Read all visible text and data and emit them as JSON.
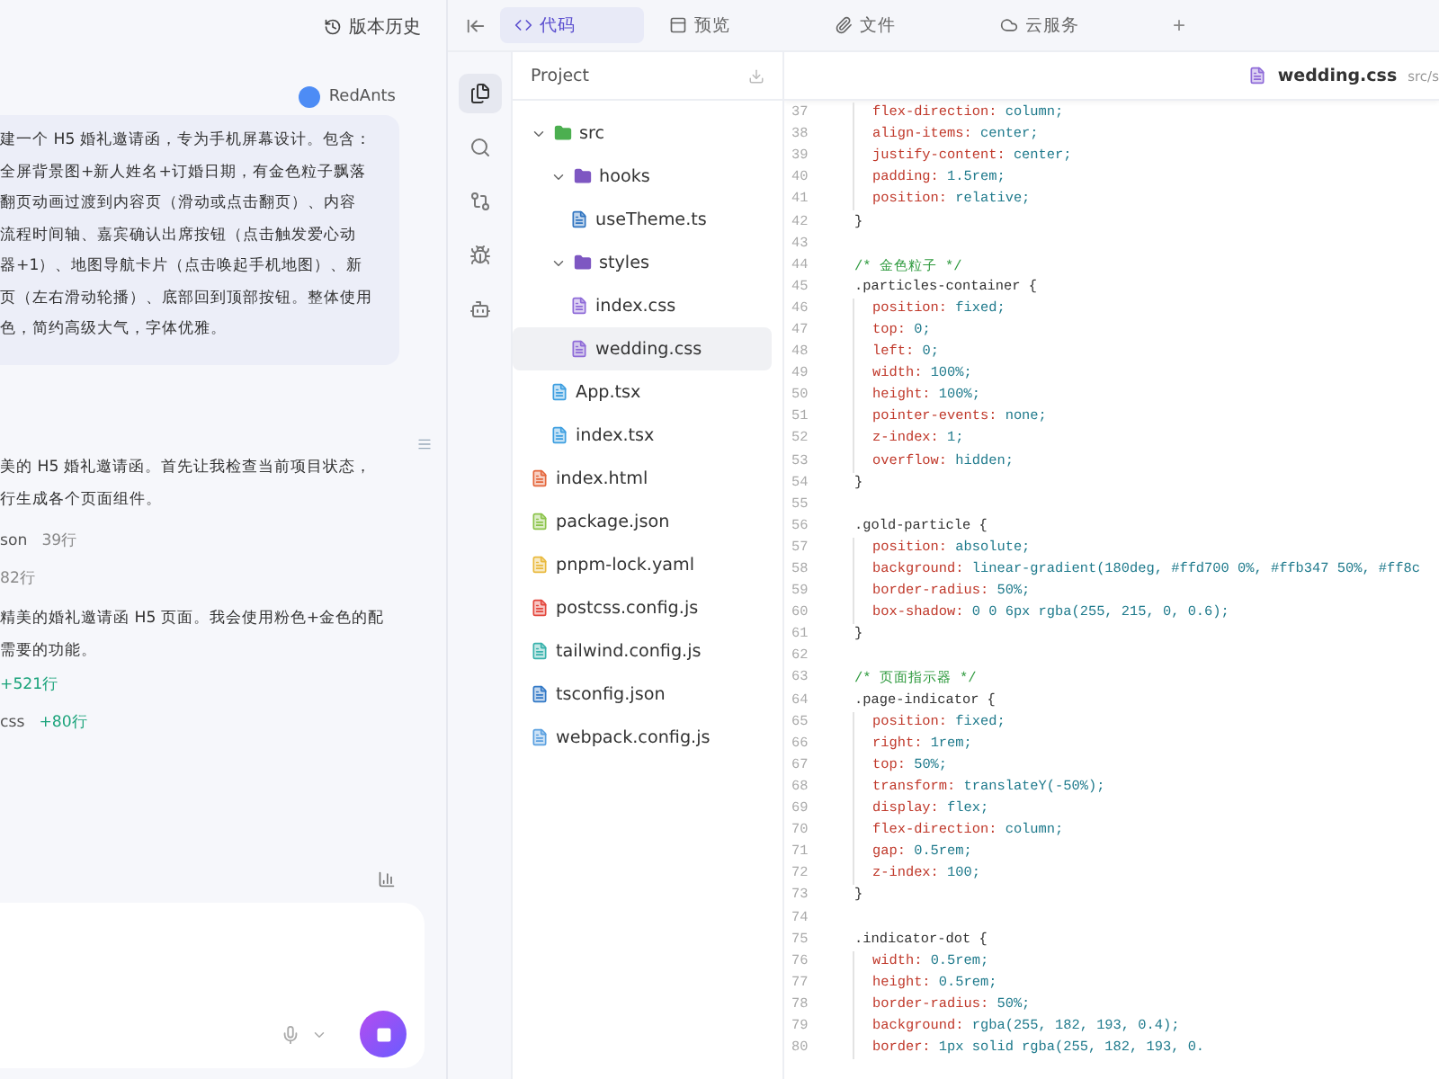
{
  "history_button": {
    "label": "版本历史"
  },
  "chat": {
    "user": {
      "name": "RedAnts",
      "lines": [
        "建一个 H5 婚礼邀请函，专为手机屏幕设计。包含：",
        "全屏背景图+新人姓名+订婚日期，有金色粒子飘落",
        "翻页动画过渡到内容页（滑动或点击翻页）、内容",
        "流程时间轴、嘉宾确认出席按钮（点击触发爱心动",
        "器+1）、地图导航卡片（点击唤起手机地图）、新",
        "页（左右滑动轮播）、底部回到顶部按钮。整体使用",
        "色，简约高级大气，字体优雅。"
      ]
    },
    "reply_1": [
      "美的 H5 婚礼邀请函。首先让我检查当前项目状态，",
      "行生成各个页面组件。"
    ],
    "file_ops_1": [
      {
        "name": "son",
        "delta": "39行",
        "kind": "read"
      },
      {
        "delta": "82行",
        "kind": "read"
      }
    ],
    "reply_2": [
      "精美的婚礼邀请函 H5 页面。我会使用粉色+金色的配",
      "需要的功能。"
    ],
    "file_ops_2": [
      {
        "delta": "+521行",
        "kind": "added"
      },
      {
        "name": "css",
        "delta": "+80行",
        "kind": "added"
      }
    ]
  },
  "tabs": [
    {
      "label": "代码",
      "selected": true
    },
    {
      "label": "预览",
      "selected": false
    },
    {
      "label": "文件",
      "selected": false
    },
    {
      "label": "云服务",
      "selected": false
    }
  ],
  "add_tab": "+",
  "rail": [
    {
      "selected": true
    },
    {
      "selected": false
    },
    {
      "selected": false
    },
    {
      "selected": false
    },
    {
      "selected": false
    }
  ],
  "tree": {
    "title": "Project",
    "items": [
      {
        "name": "src",
        "kind": "folder",
        "expanded": true,
        "selected": false,
        "children": [
          {
            "name": "hooks",
            "kind": "folder",
            "expanded": true,
            "selected": false,
            "children": [
              {
                "name": "useTheme.ts",
                "kind": "ts",
                "selected": false
              }
            ]
          },
          {
            "name": "styles",
            "kind": "folder",
            "expanded": true,
            "selected": false,
            "children": [
              {
                "name": "index.css",
                "kind": "css",
                "selected": false
              },
              {
                "name": "wedding.css",
                "kind": "css",
                "selected": true
              }
            ]
          },
          {
            "name": "App.tsx",
            "kind": "tsx",
            "selected": false
          },
          {
            "name": "index.tsx",
            "kind": "tsx",
            "selected": false
          }
        ]
      },
      {
        "name": "index.html",
        "kind": "html",
        "selected": false
      },
      {
        "name": "package.json",
        "kind": "json",
        "selected": false
      },
      {
        "name": "pnpm-lock.yaml",
        "kind": "yaml",
        "selected": false
      },
      {
        "name": "postcss.config.js",
        "kind": "postcss",
        "selected": false
      },
      {
        "name": "tailwind.config.js",
        "kind": "tailwind",
        "selected": false
      },
      {
        "name": "tsconfig.json",
        "kind": "tsconfig",
        "selected": false
      },
      {
        "name": "webpack.config.js",
        "kind": "webpack",
        "selected": false
      }
    ]
  },
  "editor": {
    "file": "wedding.css",
    "path": "src/s",
    "lines": [
      {
        "n": "37",
        "kind": "decl",
        "property": "flex-direction:",
        "value": "column;"
      },
      {
        "n": "38",
        "kind": "decl",
        "property": "align-items:",
        "value": "center;"
      },
      {
        "n": "39",
        "kind": "decl",
        "property": "justify-content:",
        "value": "center;"
      },
      {
        "n": "40",
        "kind": "decl",
        "property": "padding:",
        "value": "1.5rem;"
      },
      {
        "n": "41",
        "kind": "decl",
        "property": "position:",
        "value": "relative;"
      },
      {
        "n": "42",
        "kind": "plain",
        "text": "}"
      },
      {
        "n": "43",
        "kind": "blank"
      },
      {
        "n": "44",
        "kind": "comment",
        "text": "/* 金色粒子 */"
      },
      {
        "n": "45",
        "kind": "plain",
        "text": ".particles-container {"
      },
      {
        "n": "46",
        "kind": "decl",
        "property": "position:",
        "value": "fixed;"
      },
      {
        "n": "47",
        "kind": "decl",
        "property": "top:",
        "value": "0;"
      },
      {
        "n": "48",
        "kind": "decl",
        "property": "left:",
        "value": "0;"
      },
      {
        "n": "49",
        "kind": "decl",
        "property": "width:",
        "value": "100%;"
      },
      {
        "n": "50",
        "kind": "decl",
        "property": "height:",
        "value": "100%;"
      },
      {
        "n": "51",
        "kind": "decl",
        "property": "pointer-events:",
        "value": "none;"
      },
      {
        "n": "52",
        "kind": "decl",
        "property": "z-index:",
        "value": "1;"
      },
      {
        "n": "53",
        "kind": "decl",
        "property": "overflow:",
        "value": "hidden;"
      },
      {
        "n": "54",
        "kind": "plain",
        "text": "}"
      },
      {
        "n": "55",
        "kind": "blank"
      },
      {
        "n": "56",
        "kind": "plain",
        "text": ".gold-particle {"
      },
      {
        "n": "57",
        "kind": "decl",
        "property": "position:",
        "value": "absolute;"
      },
      {
        "n": "58",
        "kind": "decl",
        "property": "background:",
        "value": "linear-gradient(180deg, #ffd700 0%, #ffb347 50%, #ff8c"
      },
      {
        "n": "59",
        "kind": "decl",
        "property": "border-radius:",
        "value": "50%;"
      },
      {
        "n": "60",
        "kind": "decl",
        "property": "box-shadow:",
        "value": "0 0 6px rgba(255, 215, 0, 0.6);"
      },
      {
        "n": "61",
        "kind": "plain",
        "text": "}"
      },
      {
        "n": "62",
        "kind": "blank"
      },
      {
        "n": "63",
        "kind": "comment",
        "text": "/* 页面指示器 */"
      },
      {
        "n": "64",
        "kind": "plain",
        "text": ".page-indicator {"
      },
      {
        "n": "65",
        "kind": "decl",
        "property": "position:",
        "value": "fixed;"
      },
      {
        "n": "66",
        "kind": "decl",
        "property": "right:",
        "value": "1rem;"
      },
      {
        "n": "67",
        "kind": "decl",
        "property": "top:",
        "value": "50%;"
      },
      {
        "n": "68",
        "kind": "decl",
        "property": "transform:",
        "value": "translateY(-50%);"
      },
      {
        "n": "69",
        "kind": "decl",
        "property": "display:",
        "value": "flex;"
      },
      {
        "n": "70",
        "kind": "decl",
        "property": "flex-direction:",
        "value": "column;"
      },
      {
        "n": "71",
        "kind": "decl",
        "property": "gap:",
        "value": "0.5rem;"
      },
      {
        "n": "72",
        "kind": "decl",
        "property": "z-index:",
        "value": "100;"
      },
      {
        "n": "73",
        "kind": "plain",
        "text": "}"
      },
      {
        "n": "74",
        "kind": "blank"
      },
      {
        "n": "75",
        "kind": "plain",
        "text": ".indicator-dot {"
      },
      {
        "n": "76",
        "kind": "decl",
        "property": "width:",
        "value": "0.5rem;"
      },
      {
        "n": "77",
        "kind": "decl",
        "property": "height:",
        "value": "0.5rem;"
      },
      {
        "n": "78",
        "kind": "decl",
        "property": "border-radius:",
        "value": "50%;"
      },
      {
        "n": "79",
        "kind": "decl",
        "property": "background:",
        "value": "rgba(255, 182, 193, 0.4);"
      },
      {
        "n": "80",
        "kind": "decl",
        "property": "border:",
        "value": "1px solid rgba(255, 182, 193, 0."
      }
    ]
  }
}
